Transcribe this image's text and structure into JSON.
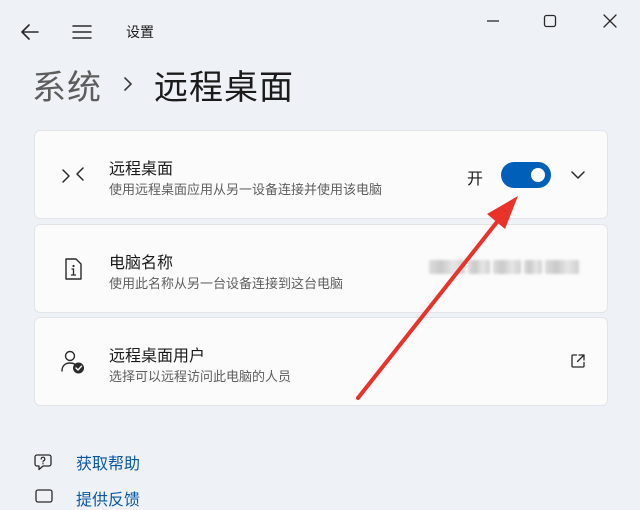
{
  "window": {
    "app_title": "设置"
  },
  "breadcrumb": {
    "parent": "系统",
    "separator": "›",
    "current": "远程桌面"
  },
  "cards": {
    "remote_desktop": {
      "title": "远程桌面",
      "subtitle": "使用远程桌面应用从另一设备连接并使用该电脑",
      "toggle_state_label": "开",
      "toggle_on": true
    },
    "pc_name": {
      "title": "电脑名称",
      "subtitle": "使用此名称从另一台设备连接到这台电脑"
    },
    "remote_users": {
      "title": "远程桌面用户",
      "subtitle": "选择可以远程访问此电脑的人员"
    }
  },
  "links": {
    "help": "获取帮助",
    "feedback": "提供反馈"
  },
  "colors": {
    "accent": "#005fb8",
    "annotation_arrow": "#e8322a",
    "background": "#eef2f7"
  }
}
